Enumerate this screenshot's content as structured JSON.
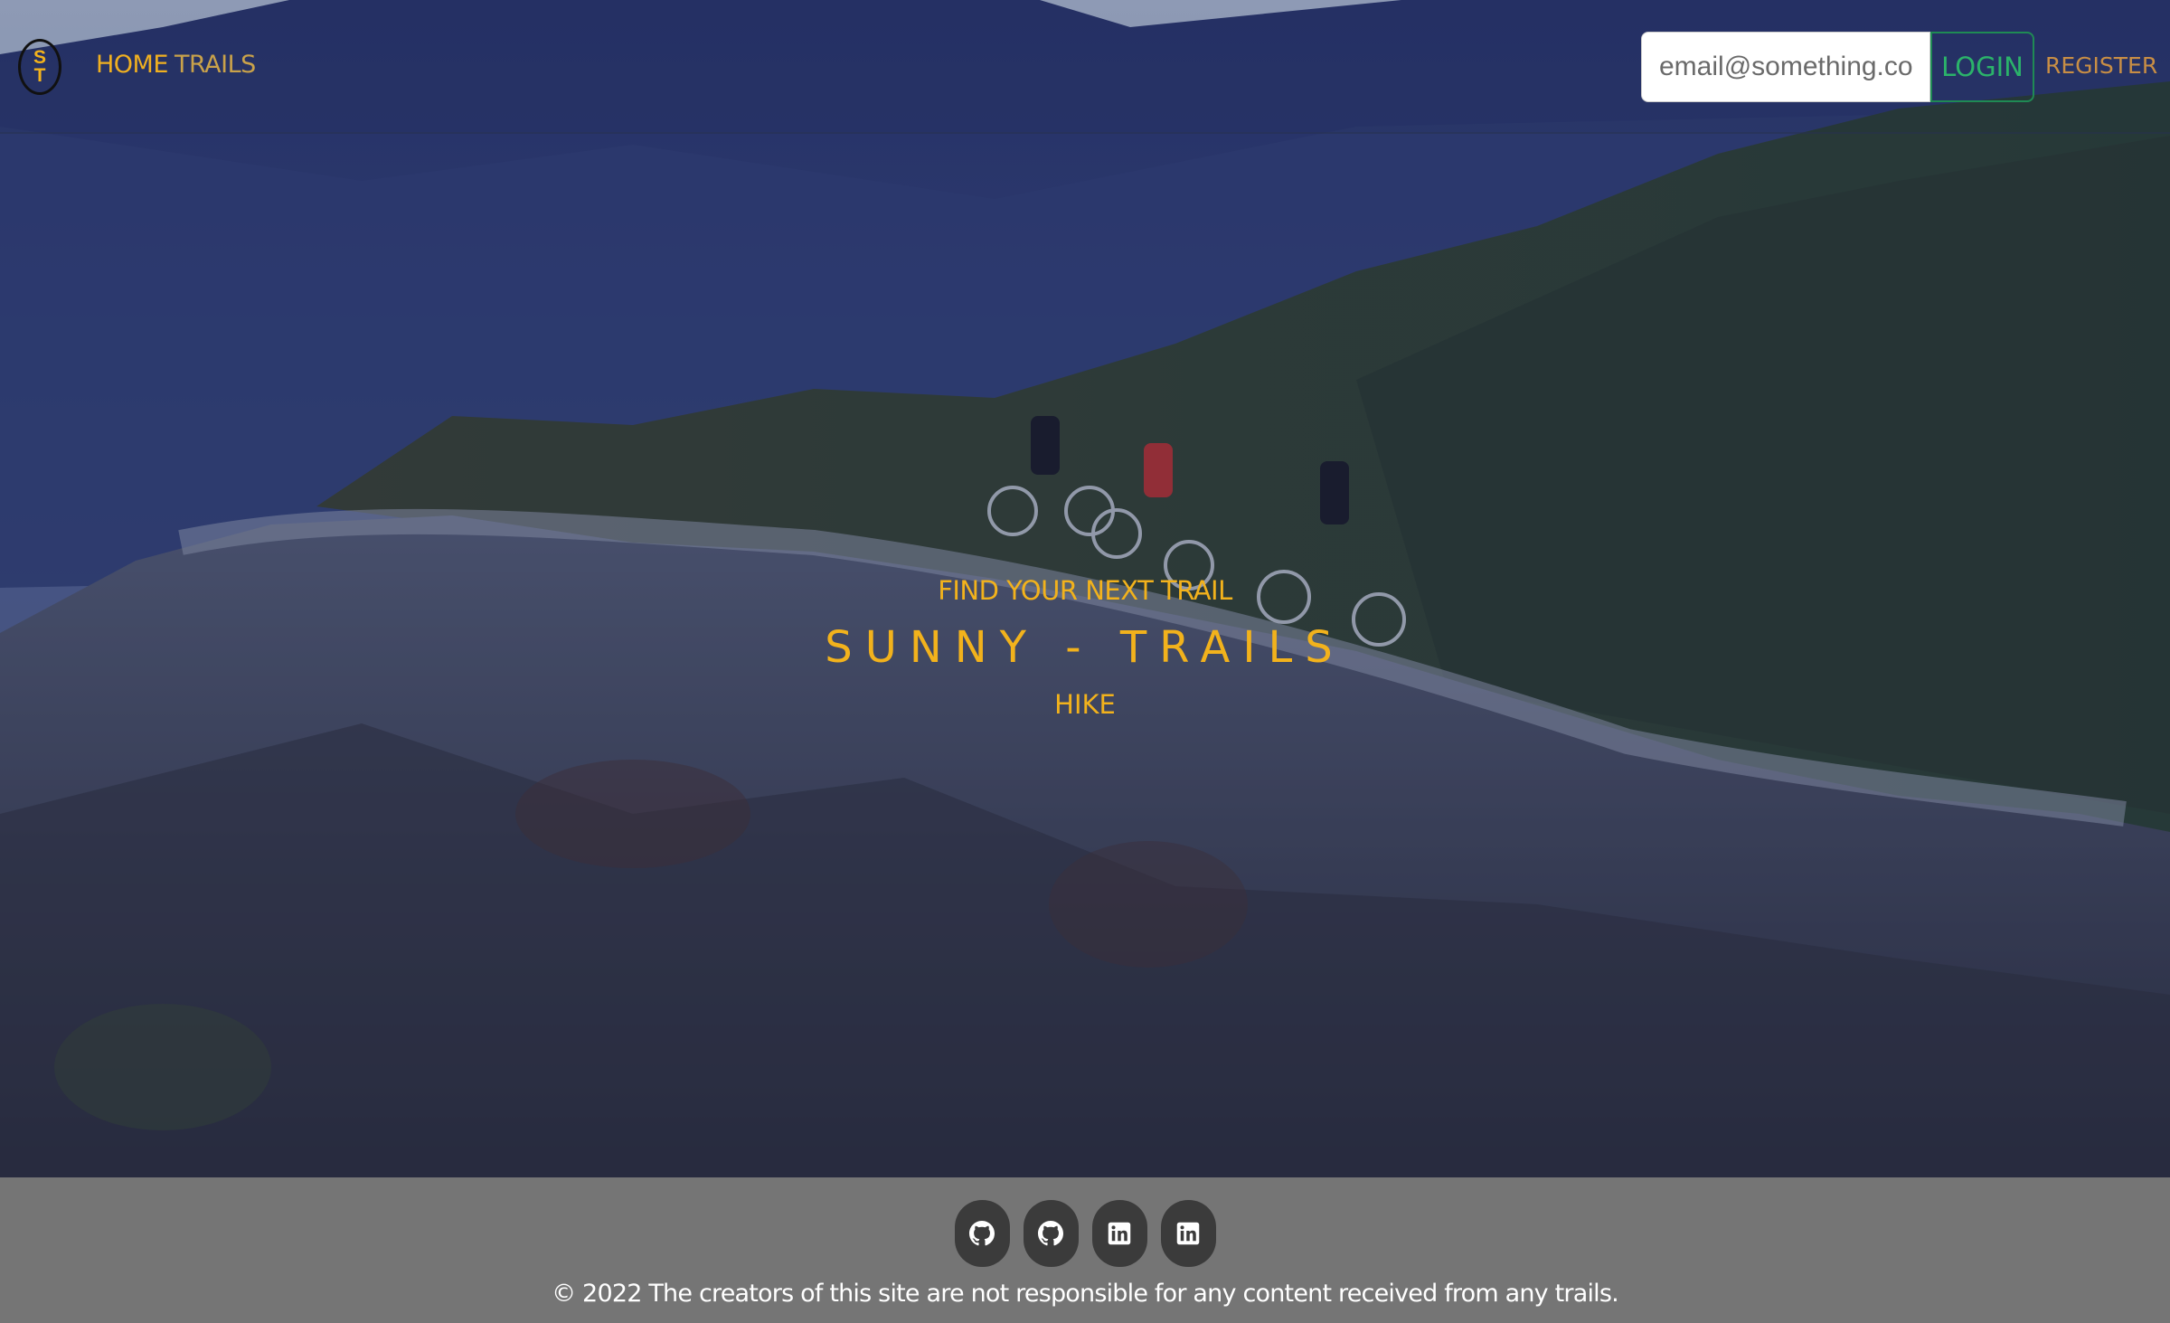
{
  "navbar": {
    "brand_letters": [
      "S",
      "T"
    ],
    "links": [
      {
        "label": "HOME"
      },
      {
        "label": "TRAILS"
      }
    ],
    "email_placeholder": "email@something.com",
    "login_label": "LOGIN",
    "register_label": "REGISTER"
  },
  "hero": {
    "subtitle": "FIND YOUR NEXT TRAIL",
    "title": "SUNNY - TRAILS",
    "tagline": "HIKE"
  },
  "footer": {
    "social": [
      {
        "icon": "github-icon"
      },
      {
        "icon": "github-icon"
      },
      {
        "icon": "linkedin-icon"
      },
      {
        "icon": "linkedin-icon"
      }
    ],
    "copyright": "© 2022 The creators of this site are not responsible for any content received from any trails."
  },
  "colors": {
    "accent": "#f2b21c",
    "login": "#2bb36a",
    "footer_bg": "#757575"
  }
}
